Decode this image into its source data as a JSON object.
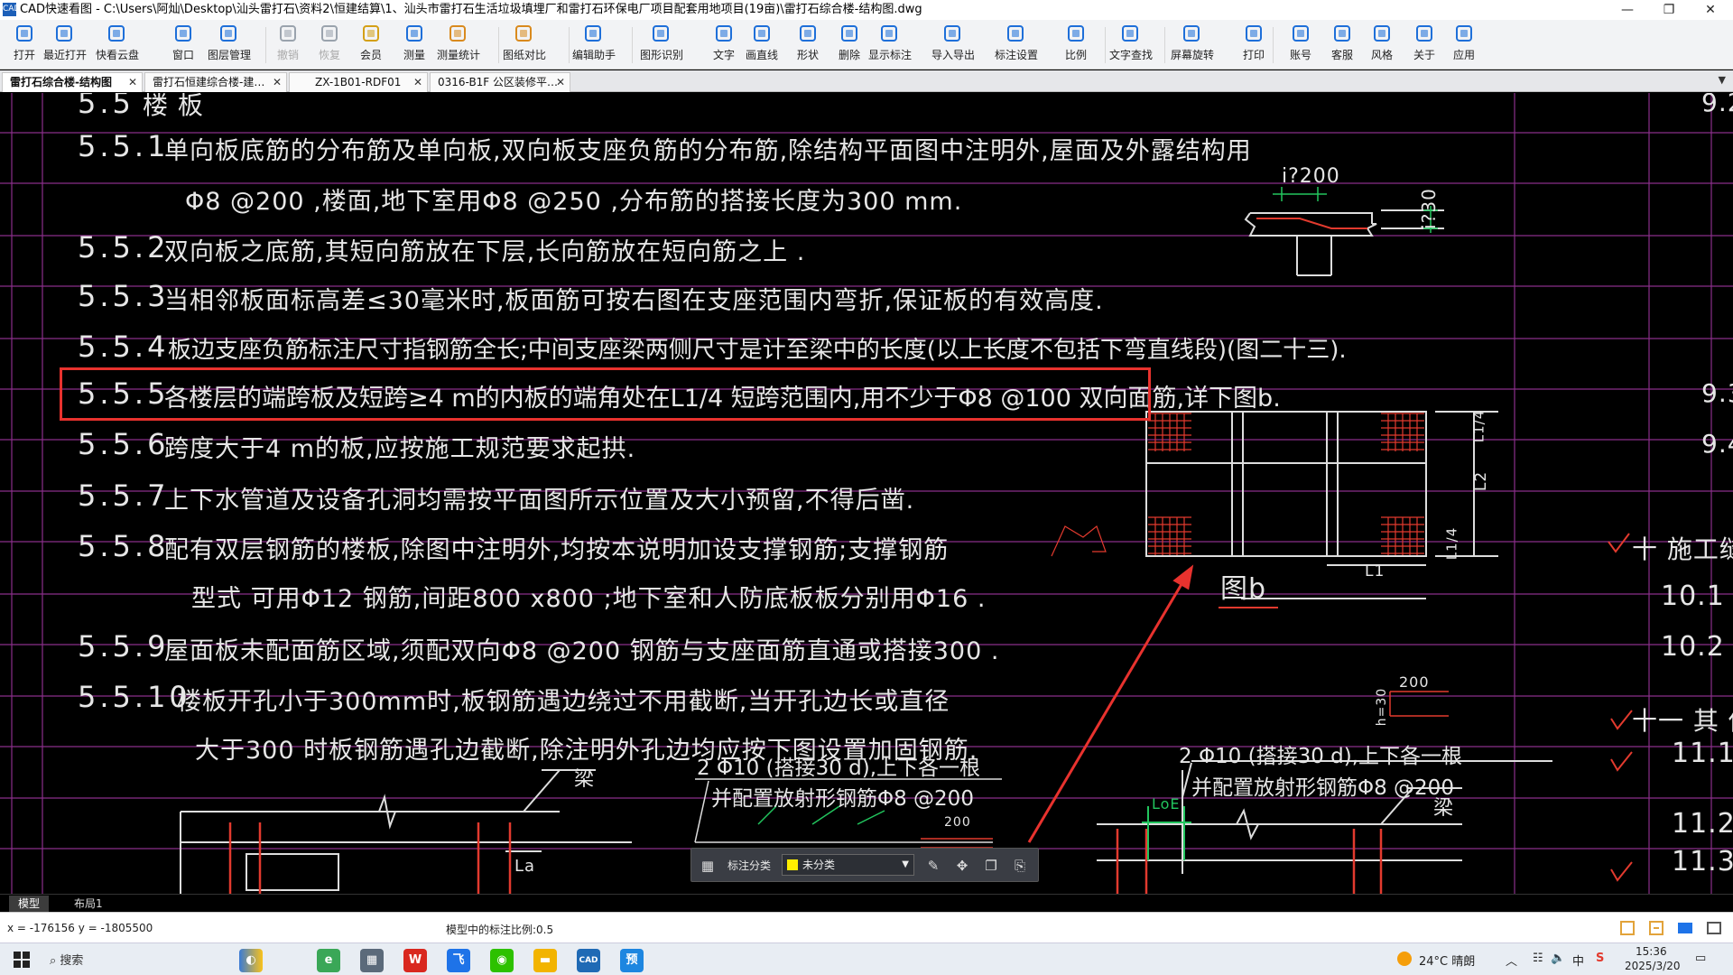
{
  "window": {
    "title": "CAD快速看图 - C:\\Users\\阿灿\\Desktop\\汕头雷打石\\资料2\\恒建结算\\1、汕头市雷打石生活垃圾填埋厂和雷打石环保电厂项目配套用地项目(19亩)\\雷打石综合楼-结构图.dwg",
    "app_icon": "CAD",
    "minimize": "—",
    "restore": "❐",
    "close": "✕"
  },
  "toolbar": [
    {
      "label": "打开",
      "icon": "folder-icon"
    },
    {
      "label": "最近打开",
      "icon": "history-icon"
    },
    {
      "label": "快看云盘",
      "icon": "cloud-icon"
    },
    {
      "label": "窗口",
      "icon": "window-icon"
    },
    {
      "label": "图层管理",
      "icon": "layers-icon"
    },
    {
      "label": "撤销",
      "icon": "undo-icon"
    },
    {
      "label": "恢复",
      "icon": "redo-icon"
    },
    {
      "label": "会员",
      "icon": "vip-icon"
    },
    {
      "label": "测量",
      "icon": "measure-icon"
    },
    {
      "label": "测量统计",
      "icon": "measure-stats-icon"
    },
    {
      "label": "图纸对比",
      "icon": "compare-icon"
    },
    {
      "label": "编辑助手",
      "icon": "edit-assistant-icon"
    },
    {
      "label": "图形识别",
      "icon": "shape-recognition-icon"
    },
    {
      "label": "文字",
      "icon": "text-icon"
    },
    {
      "label": "画直线",
      "icon": "line-icon"
    },
    {
      "label": "形状",
      "icon": "shape-icon"
    },
    {
      "label": "删除",
      "icon": "eraser-icon"
    },
    {
      "label": "显示标注",
      "icon": "eye-icon"
    },
    {
      "label": "导入导出",
      "icon": "import-export-icon"
    },
    {
      "label": "标注设置",
      "icon": "annotation-settings-icon"
    },
    {
      "label": "比例",
      "icon": "scale-icon"
    },
    {
      "label": "文字查找",
      "icon": "text-search-icon"
    },
    {
      "label": "屏幕旋转",
      "icon": "rotate-screen-icon"
    },
    {
      "label": "打印",
      "icon": "printer-icon"
    },
    {
      "label": "账号",
      "icon": "user-icon"
    },
    {
      "label": "客服",
      "icon": "headset-icon"
    },
    {
      "label": "风格",
      "icon": "style-icon"
    },
    {
      "label": "关于",
      "icon": "info-icon"
    },
    {
      "label": "应用",
      "icon": "apps-icon"
    }
  ],
  "tabs": [
    {
      "label": "雷打石综合楼-结构图",
      "close": "✕"
    },
    {
      "label": "雷打石恒建综合楼-建…",
      "close": "✕"
    },
    {
      "label": "ZX-1B01-RDF01",
      "close": "✕"
    },
    {
      "label": "0316-B1F 公区装修平…",
      "close": "✕"
    }
  ],
  "tabs_overflow": "▼",
  "drawing": {
    "lines": [
      {
        "num": "5.5",
        "text": "楼 板"
      },
      {
        "num": "5.5.1",
        "text": "单向板底筋的分布筋及单向板,双向板支座负筋的分布筋,除结构平面图中注明外,屋面及外露结构用"
      },
      {
        "num": "",
        "text": "Φ8 @200 ,楼面,地下室用Φ8 @250 ,分布筋的搭接长度为300 mm."
      },
      {
        "num": "5.5.2",
        "text": "双向板之底筋,其短向筋放在下层,长向筋放在短向筋之上 ."
      },
      {
        "num": "5.5.3",
        "text": "当相邻板面标高差≤30毫米时,板面筋可按右图在支座范围内弯折,保证板的有效高度."
      },
      {
        "num": "5.5.4",
        "text": "板边支座负筋标注尺寸指钢筋全长;中间支座梁两侧尺寸是计至梁中的长度(以上长度不包括下弯直线段)(图二十三)."
      },
      {
        "num": "5.5.5",
        "text": "各楼层的端跨板及短跨≥4 m的内板的端角处在L1/4 短跨范围内,用不少于Φ8 @100 双向面筋,详下图b."
      },
      {
        "num": "5.5.6",
        "text": "跨度大于4 m的板,应按施工规范要求起拱."
      },
      {
        "num": "5.5.7",
        "text": "上下水管道及设备孔洞均需按平面图所示位置及大小预留,不得后凿."
      },
      {
        "num": "5.5.8",
        "text": "配有双层钢筋的楼板,除图中注明外,均按本说明加设支撑钢筋;支撑钢筋"
      },
      {
        "num": "",
        "text": "型式 可用Φ12 钢筋,间距800 x800 ;地下室和人防底板板分别用Φ16 ."
      },
      {
        "num": "5.5.9",
        "text": "屋面板未配面筋区域,须配双向Φ8 @200 钢筋与支座面筋直通或搭接300 ."
      },
      {
        "num": "5.5.10",
        "text": "楼板开孔小于300mm时,板钢筋遇边绕过不用截断,当开孔边长或直径"
      },
      {
        "num": "",
        "text": "大于300 时板钢筋遇孔边截断,除注明外孔边均应按下图设置加固钢筋."
      }
    ],
    "comma": ",",
    "detail_labels": {
      "i200": "i?200",
      "i30": "i?30",
      "fig_b": "图b",
      "L1": "L1",
      "L2": "L2",
      "L1_4a": "L1/4",
      "L1_4b": "L1/4"
    },
    "right_col": {
      "r1": "9.2",
      "r2": "9.3",
      "r3": "9.4",
      "r4": "十 施工缝的",
      "r5": "10.1",
      "r6": "10.2",
      "r7": "十一 其 他",
      "r8": "11.1",
      "r9": "11.2",
      "r10": "11.3"
    },
    "bottom_notes": {
      "left_beam": "梁",
      "left_la": "La",
      "mid1": "2 Φ10 (搭接30 d),上下各一根",
      "mid2": "并配置放射形钢筋Φ8 @200",
      "mid_200": "200",
      "right1": "2 Φ10 (搭接30 d),上下各一根",
      "right2": "并配置放射形钢筋Φ8 @200",
      "right_loe": "LoE",
      "right_beam": "梁",
      "h30": "h=30",
      "top200": "200"
    }
  },
  "floatbar": {
    "label": "标注分类",
    "select_value": "未分类",
    "select_arrow": "▼",
    "swatch_color": "#ffee00"
  },
  "layout_tabs": [
    "模型",
    "布局1"
  ],
  "status": {
    "coords": "x = -176156 y = -1805500",
    "scale": "模型中的标注比例:0.5"
  },
  "taskbar": {
    "search": "搜索",
    "weather": "24°C 晴朗",
    "ime": "中",
    "time": "15:36",
    "date": "2025/3/20",
    "apps": [
      {
        "icon": "browser-icon",
        "glyph": "e",
        "color": "#3aa757"
      },
      {
        "icon": "calculator-icon",
        "glyph": "▦",
        "color": "#5b6a7a"
      },
      {
        "icon": "wps-icon",
        "glyph": "W",
        "color": "#d9281f"
      },
      {
        "icon": "feishu-icon",
        "glyph": "飞",
        "color": "#1e73e8"
      },
      {
        "icon": "wechat-icon",
        "glyph": "◉",
        "color": "#2dc100"
      },
      {
        "icon": "file-explorer-icon",
        "glyph": "▬",
        "color": "#f2b400"
      },
      {
        "icon": "cad-viewer-icon",
        "glyph": "CAD",
        "color": "#1f6ab5"
      },
      {
        "icon": "preview-icon",
        "glyph": "预",
        "color": "#1d86e0"
      }
    ]
  }
}
